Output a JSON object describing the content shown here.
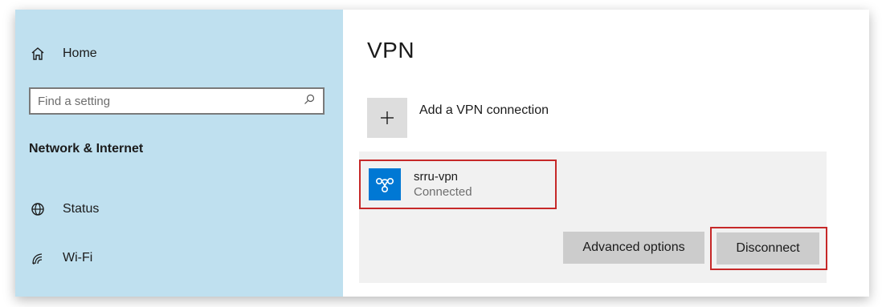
{
  "sidebar": {
    "home_label": "Home",
    "search_placeholder": "Find a setting",
    "section_heading": "Network & Internet",
    "items": [
      {
        "label": "Status",
        "icon": "globe-icon"
      },
      {
        "label": "Wi-Fi",
        "icon": "wifi-icon"
      }
    ]
  },
  "main": {
    "title": "VPN",
    "add_connection_label": "Add a VPN connection",
    "connection": {
      "name": "srru-vpn",
      "status": "Connected"
    },
    "buttons": {
      "advanced": "Advanced options",
      "disconnect": "Disconnect"
    }
  },
  "colors": {
    "sidebar_bg": "#bfe0ef",
    "accent": "#0078d4",
    "highlight_border": "#c62828",
    "panel_bg": "#f1f1f1",
    "button_bg": "#cccccc"
  }
}
